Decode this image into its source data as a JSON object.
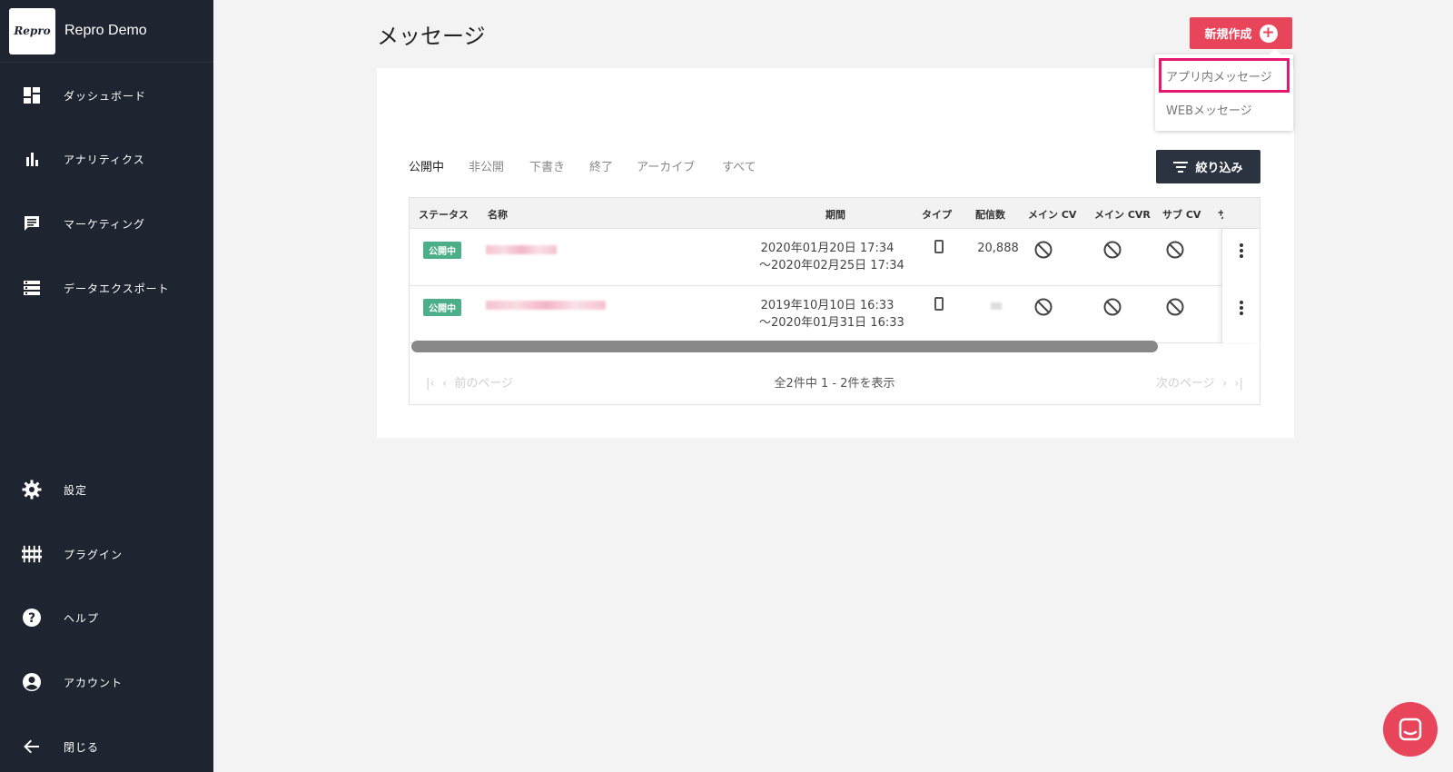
{
  "sidebar": {
    "logo": "Repro",
    "app_name": "Repro Demo",
    "items": [
      {
        "label": "ダッシュボード",
        "icon": "dashboard-icon"
      },
      {
        "label": "アナリティクス",
        "icon": "bar-chart-icon"
      },
      {
        "label": "マーケティング",
        "icon": "message-icon"
      },
      {
        "label": "データエクスポート",
        "icon": "storage-icon"
      }
    ],
    "bottom_items": [
      {
        "label": "設定",
        "icon": "gear-icon"
      },
      {
        "label": "プラグイン",
        "icon": "plugin-icon"
      },
      {
        "label": "ヘルプ",
        "icon": "help-icon"
      },
      {
        "label": "アカウント",
        "icon": "account-icon"
      },
      {
        "label": "閉じる",
        "icon": "arrow-left-icon"
      }
    ]
  },
  "header": {
    "title": "メッセージ",
    "new_button": "新規作成"
  },
  "dropdown": {
    "items": [
      "アプリ内メッセージ",
      "WEBメッセージ"
    ]
  },
  "tabs": [
    "公開中",
    "非公開",
    "下書き",
    "終了",
    "アーカイブ",
    "すべて"
  ],
  "filter_button": "絞り込み",
  "table": {
    "columns": [
      "ステータス",
      "名称",
      "期間",
      "タイプ",
      "配信数",
      "メイン CV",
      "メイン CVR",
      "サブ CV",
      "サ"
    ],
    "rows": [
      {
        "status": "公開中",
        "period_start": "2020年01月20日 17:34",
        "period_end": "〜2020年02月25日 17:34",
        "deliveries": "20,888"
      },
      {
        "status": "公開中",
        "period_start": "2019年10月10日 16:33",
        "period_end": "〜2020年01月31日 16:33",
        "deliveries": ""
      }
    ]
  },
  "pager": {
    "prev": "前のページ",
    "info": "全2件中 1 - 2件を表示",
    "next": "次のページ"
  },
  "colors": {
    "sidebar_bg": "#1e2430",
    "accent": "#e8455b",
    "badge_green": "#4caf8a",
    "highlight": "#e6176f"
  }
}
